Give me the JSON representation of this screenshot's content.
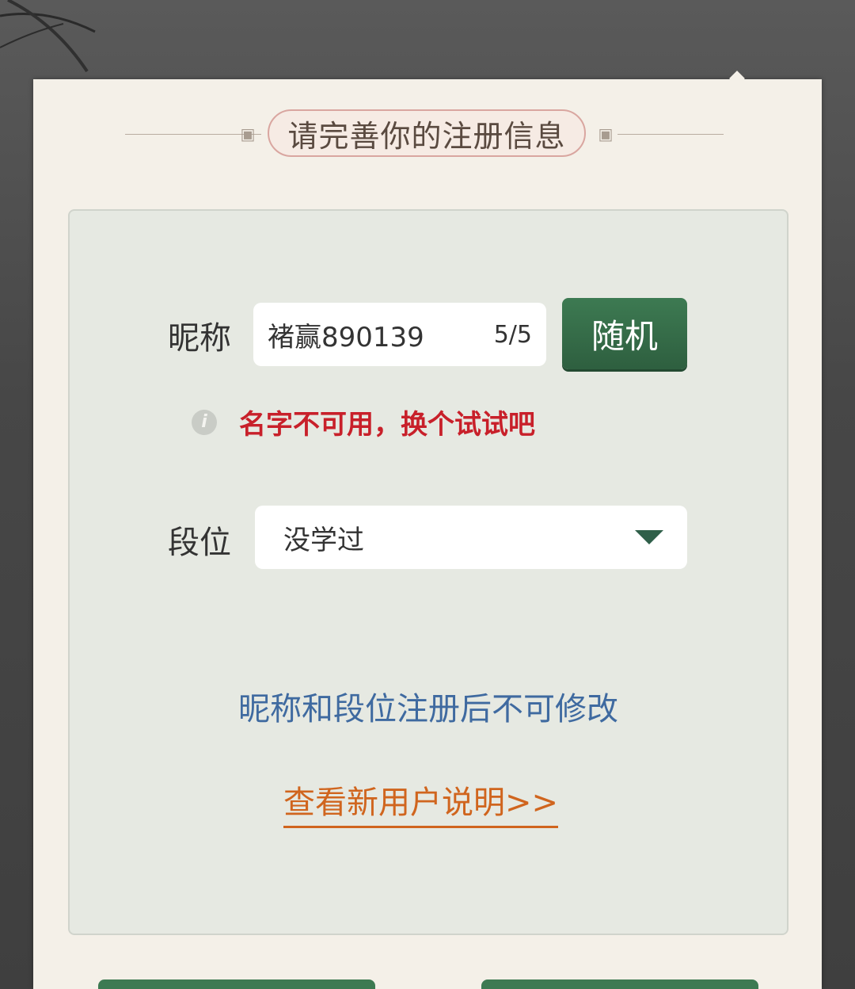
{
  "dialog": {
    "title": "请完善你的注册信息"
  },
  "form": {
    "nickname": {
      "label": "昵称",
      "value": "褚赢890139",
      "counter": "5/5",
      "random_button": "随机"
    },
    "error_message": "名字不可用，换个试试吧",
    "rank": {
      "label": "段位",
      "selected": "没学过"
    },
    "notice": "昵称和段位注册后不可修改",
    "guide_link": "查看新用户说明>>"
  },
  "colors": {
    "accent_green": "#3d7a52",
    "error_red": "#c8202a",
    "notice_blue": "#3f6aa0",
    "link_orange": "#d0651e"
  },
  "icons": {
    "info": "info-icon",
    "dropdown": "caret-down-icon"
  }
}
